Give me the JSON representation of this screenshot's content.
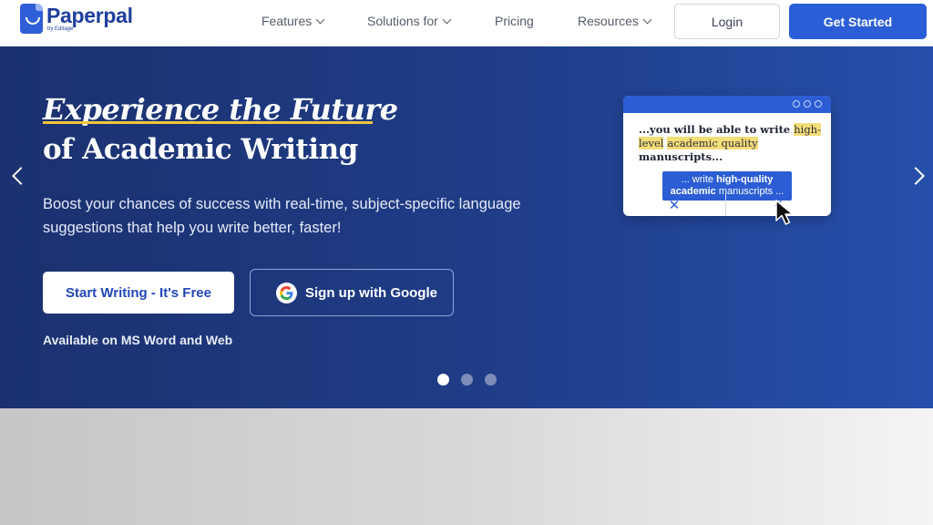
{
  "nav": {
    "brand": "Paperpal",
    "brand_sub": "by Editage",
    "items": [
      {
        "label": "Features",
        "has_dropdown": true
      },
      {
        "label": "Solutions for",
        "has_dropdown": true
      },
      {
        "label": "Pricing",
        "has_dropdown": false
      },
      {
        "label": "Resources",
        "has_dropdown": true
      }
    ],
    "login_label": "Login",
    "get_started_label": "Get Started"
  },
  "hero": {
    "headline_1": "Experience the Future",
    "headline_2": "of Academic Writing",
    "subtext": "Boost your chances of success with real-time, subject-specific language suggestions that help you write better, faster!",
    "cta_primary": "Start Writing - It's Free",
    "cta_google": "Sign up with Google",
    "availability": "Available on MS Word and Web",
    "carousel": {
      "count": 3,
      "active_index": 0
    }
  },
  "illustration": {
    "sentence_pre": "...you will be able to write ",
    "highlight_1": "high-level",
    "highlight_2": "academic quality",
    "sentence_post": " manuscripts...",
    "suggestion_pre": "... write ",
    "suggestion_bold_1": "high-quality",
    "suggestion_bold_2": "academic",
    "suggestion_post": " manuscripts ...",
    "reject_symbol": "✕",
    "accept_symbol": "✓"
  },
  "colors": {
    "brand_blue": "#2b5ed6",
    "hero_dark": "#1b316f",
    "highlight_yellow": "#f3c53b"
  },
  "icons": {
    "carousel_prev": "chevron-left-icon",
    "carousel_next": "chevron-right-icon",
    "google": "google-g-icon",
    "cursor": "mouse-pointer-icon"
  }
}
